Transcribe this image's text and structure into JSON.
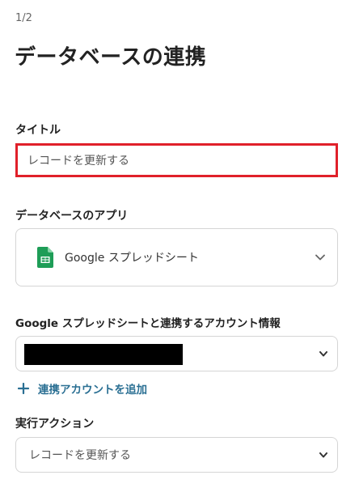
{
  "header": {
    "step": "1/2",
    "title": "データベースの連携"
  },
  "title_field": {
    "label": "タイトル",
    "value": "レコードを更新する",
    "highlight_color": "#e0202a"
  },
  "app_field": {
    "label": "データベースのアプリ",
    "selected_app": "Google スプレッドシート",
    "app_icon": "google-sheets-icon",
    "icon_color": "#1e9d57"
  },
  "account_field": {
    "label": "Google スプレッドシートと連携するアカウント情報",
    "add_account_label": "連携アカウントを追加",
    "add_icon": "plus-icon",
    "link_color": "#2a6f93"
  },
  "action_field": {
    "label": "実行アクション",
    "selected_action": "レコードを更新する"
  }
}
